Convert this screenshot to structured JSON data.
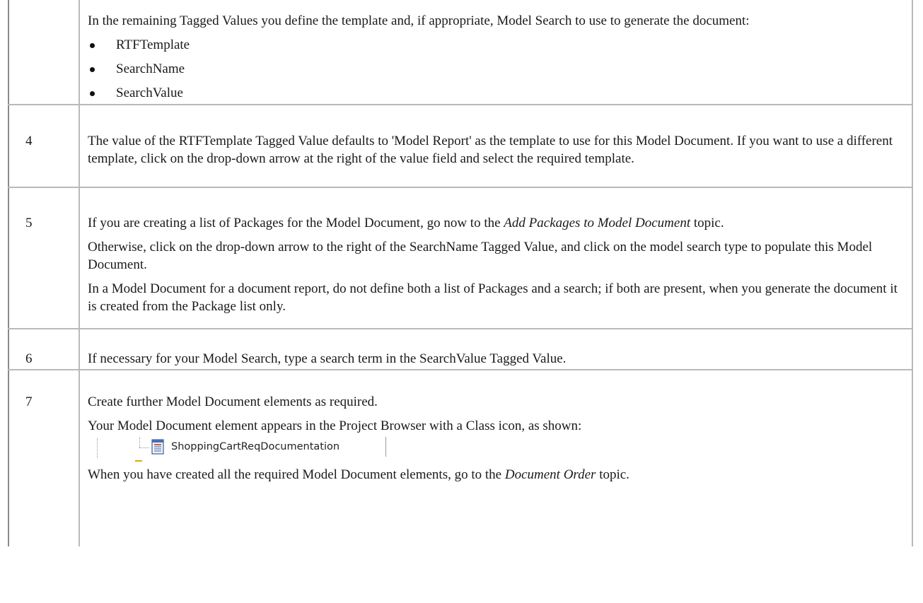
{
  "intro_cell": {
    "paragraph": "In the remaining Tagged Values you define the template and, if appropriate, Model Search to use to generate the document:",
    "bullets": [
      "RTFTemplate",
      "SearchName",
      "SearchValue"
    ]
  },
  "steps": [
    {
      "number": "4",
      "p1": "The value of the RTFTemplate Tagged Value defaults to 'Model Report' as the template to use for this Model Document. If you want to use a different template, click on the drop-down arrow at the right of the value field and select the required template."
    },
    {
      "number": "5",
      "p1_before": "If you are creating a list of Packages for the Model Document, go now to the ",
      "p1_link": "Add Packages to Model Document",
      "p1_after": " topic.",
      "p2": "Otherwise, click on the drop-down arrow to the right of the SearchName Tagged Value, and click on the model search type to populate this Model Document.",
      "p3": "In a Model Document for a document report, do not define both a list of Packages and a search; if both are present, when you generate the document it is created from the Package list only."
    },
    {
      "number": "6",
      "p1": "If necessary for your Model Search, type a search term in the SearchValue Tagged Value."
    },
    {
      "number": "7",
      "p1": "Create further Model Document elements as required.",
      "p2": "Your Model Document element appears in the Project Browser with a Class icon, as shown:",
      "browser_item": "ShoppingCartReqDocumentation",
      "p3_before": "When you have created all the required Model Document elements, go to the ",
      "p3_link": "Document Order",
      "p3_after": " topic."
    }
  ],
  "icons": {
    "model_document": "model-document-icon"
  }
}
